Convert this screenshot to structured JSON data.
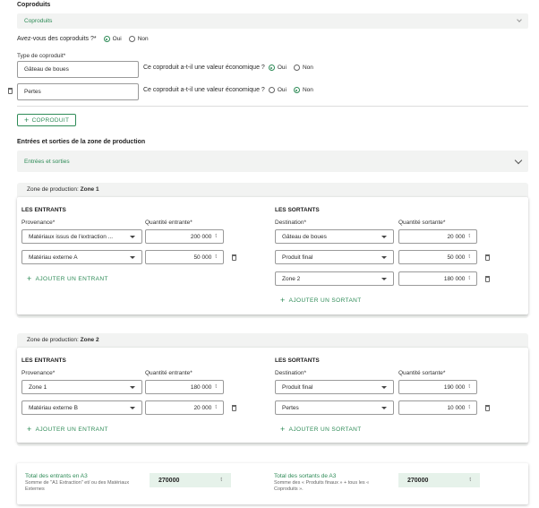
{
  "coproduits": {
    "title": "Coproduits",
    "accordion_label": "Coproduits",
    "question": "Avez-vous des coproduits ?*",
    "oui": "Oui",
    "non": "Non",
    "type_label": "Type de coproduit*",
    "rows": [
      {
        "value": "Gâteau de boues",
        "question": "Ce coproduit a-t-il une valeur économique ?",
        "oui": "Oui",
        "non": "Non",
        "selected": "oui"
      },
      {
        "value": "Pertes",
        "question": "Ce coproduit a-t-il une valeur économique ?",
        "oui": "Oui",
        "non": "Non",
        "selected": "non"
      }
    ],
    "add_button": "COPRODUIT"
  },
  "entrees": {
    "title": "Entrées et sorties de la zone de production",
    "accordion_label": "Entrées et sorties"
  },
  "zone1": {
    "header_prefix": "Zone de production:",
    "header_name": "Zone 1",
    "entrants_title": "LES ENTRANTS",
    "sortants_title": "LES SORTANTS",
    "provenance_label": "Provenance*",
    "qte_entrante_label": "Quantité entrante*",
    "destination_label": "Destination*",
    "qte_sortante_label": "Quantité sortante*",
    "entrants": [
      {
        "select": "Matériaux issus de l'extraction ...",
        "qty": "200 000",
        "unit": "t"
      },
      {
        "select": "Matériau externe A",
        "qty": "50 000",
        "unit": "t"
      }
    ],
    "sortants": [
      {
        "select": "Gâteau de boues",
        "qty": "20 000",
        "unit": "t"
      },
      {
        "select": "Produit final",
        "qty": "50 000",
        "unit": "t"
      },
      {
        "select": "Zone 2",
        "qty": "180 000",
        "unit": "t"
      }
    ],
    "add_entrant": "AJOUTER UN ENTRANT",
    "add_sortant": "AJOUTER UN SORTANT"
  },
  "zone2": {
    "header_prefix": "Zone de production:",
    "header_name": "Zone 2",
    "entrants_title": "LES ENTRANTS",
    "sortants_title": "LES SORTANTS",
    "provenance_label": "Provenance*",
    "qte_entrante_label": "Quantité entrante*",
    "destination_label": "Destination*",
    "qte_sortante_label": "Quantité sortante*",
    "entrants": [
      {
        "select": "Zone 1",
        "qty": "180 000",
        "unit": "t"
      },
      {
        "select": "Matériau externe B",
        "qty": "20 000",
        "unit": "t"
      }
    ],
    "sortants": [
      {
        "select": "Produit final",
        "qty": "190 000",
        "unit": "t"
      },
      {
        "select": "Pertes",
        "qty": "10 000",
        "unit": "t"
      }
    ],
    "add_entrant": "AJOUTER UN ENTRANT",
    "add_sortant": "AJOUTER UN SORTANT"
  },
  "totals": {
    "entrants_title": "Total des entrants en A3",
    "entrants_desc": "Somme de \"A1 Extraction\" et/ ou des Matériaux Externes",
    "entrants_value": "270000",
    "entrants_unit": "t",
    "sortants_title": "Total des sortants de A3",
    "sortants_desc": "Somme des « Produits finaux » + tous les « Coproduits ».",
    "sortants_value": "270000",
    "sortants_unit": "t"
  },
  "colors": {
    "accent": "#2e8b57",
    "panel": "#f2f3f2",
    "total_bg": "#e6f2ea"
  }
}
